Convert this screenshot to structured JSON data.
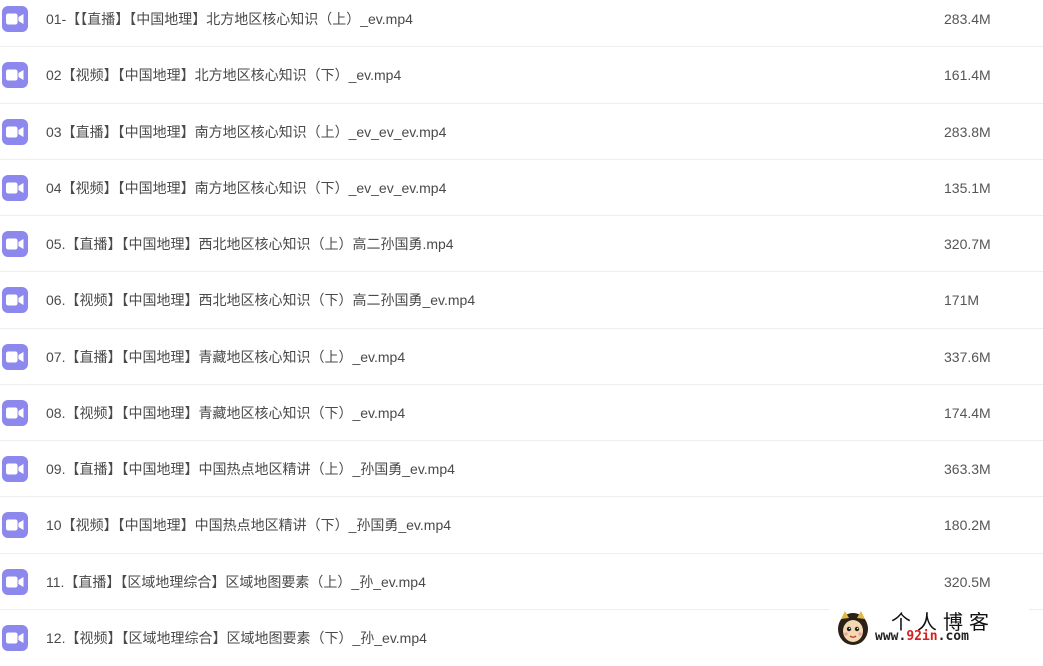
{
  "files": [
    {
      "name": "01-【【直播】【中国地理】北方地区核心知识（上）_ev.mp4",
      "size": "283.4M",
      "icon": "video-icon"
    },
    {
      "name": "02【视频】【中国地理】北方地区核心知识（下）_ev.mp4",
      "size": "161.4M",
      "icon": "video-icon"
    },
    {
      "name": "03【直播】【中国地理】南方地区核心知识（上）_ev_ev_ev.mp4",
      "size": "283.8M",
      "icon": "video-icon"
    },
    {
      "name": "04【视频】【中国地理】南方地区核心知识（下）_ev_ev_ev.mp4",
      "size": "135.1M",
      "icon": "video-icon"
    },
    {
      "name": "05.【直播】【中国地理】西北地区核心知识（上）高二孙国勇.mp4",
      "size": "320.7M",
      "icon": "video-icon"
    },
    {
      "name": "06.【视频】【中国地理】西北地区核心知识（下）高二孙国勇_ev.mp4",
      "size": "171M",
      "icon": "video-icon"
    },
    {
      "name": "07.【直播】【中国地理】青藏地区核心知识（上）_ev.mp4",
      "size": "337.6M",
      "icon": "video-icon"
    },
    {
      "name": "08.【视频】【中国地理】青藏地区核心知识（下）_ev.mp4",
      "size": "174.4M",
      "icon": "video-icon"
    },
    {
      "name": "09.【直播】【中国地理】中国热点地区精讲（上）_孙国勇_ev.mp4",
      "size": "363.3M",
      "icon": "video-icon"
    },
    {
      "name": "10【视频】【中国地理】中国热点地区精讲（下）_孙国勇_ev.mp4",
      "size": "180.2M",
      "icon": "video-icon"
    },
    {
      "name": "11.【直播】【区域地理综合】区域地图要素（上）_孙_ev.mp4",
      "size": "320.5M",
      "icon": "video-icon"
    },
    {
      "name": "12.【视频】【区域地理综合】区域地图要素（下）_孙_ev.mp4",
      "size": "",
      "icon": "video-icon"
    }
  ],
  "watermark": {
    "title": "个人博客",
    "url_prefix": "www.",
    "url_accent": "92in",
    "url_suffix": ".com"
  },
  "colors": {
    "icon_background": "#8c88ee",
    "row_divider": "#eeeef1",
    "text": "#4a4a4a",
    "watermark_accent": "#d81e1e"
  }
}
